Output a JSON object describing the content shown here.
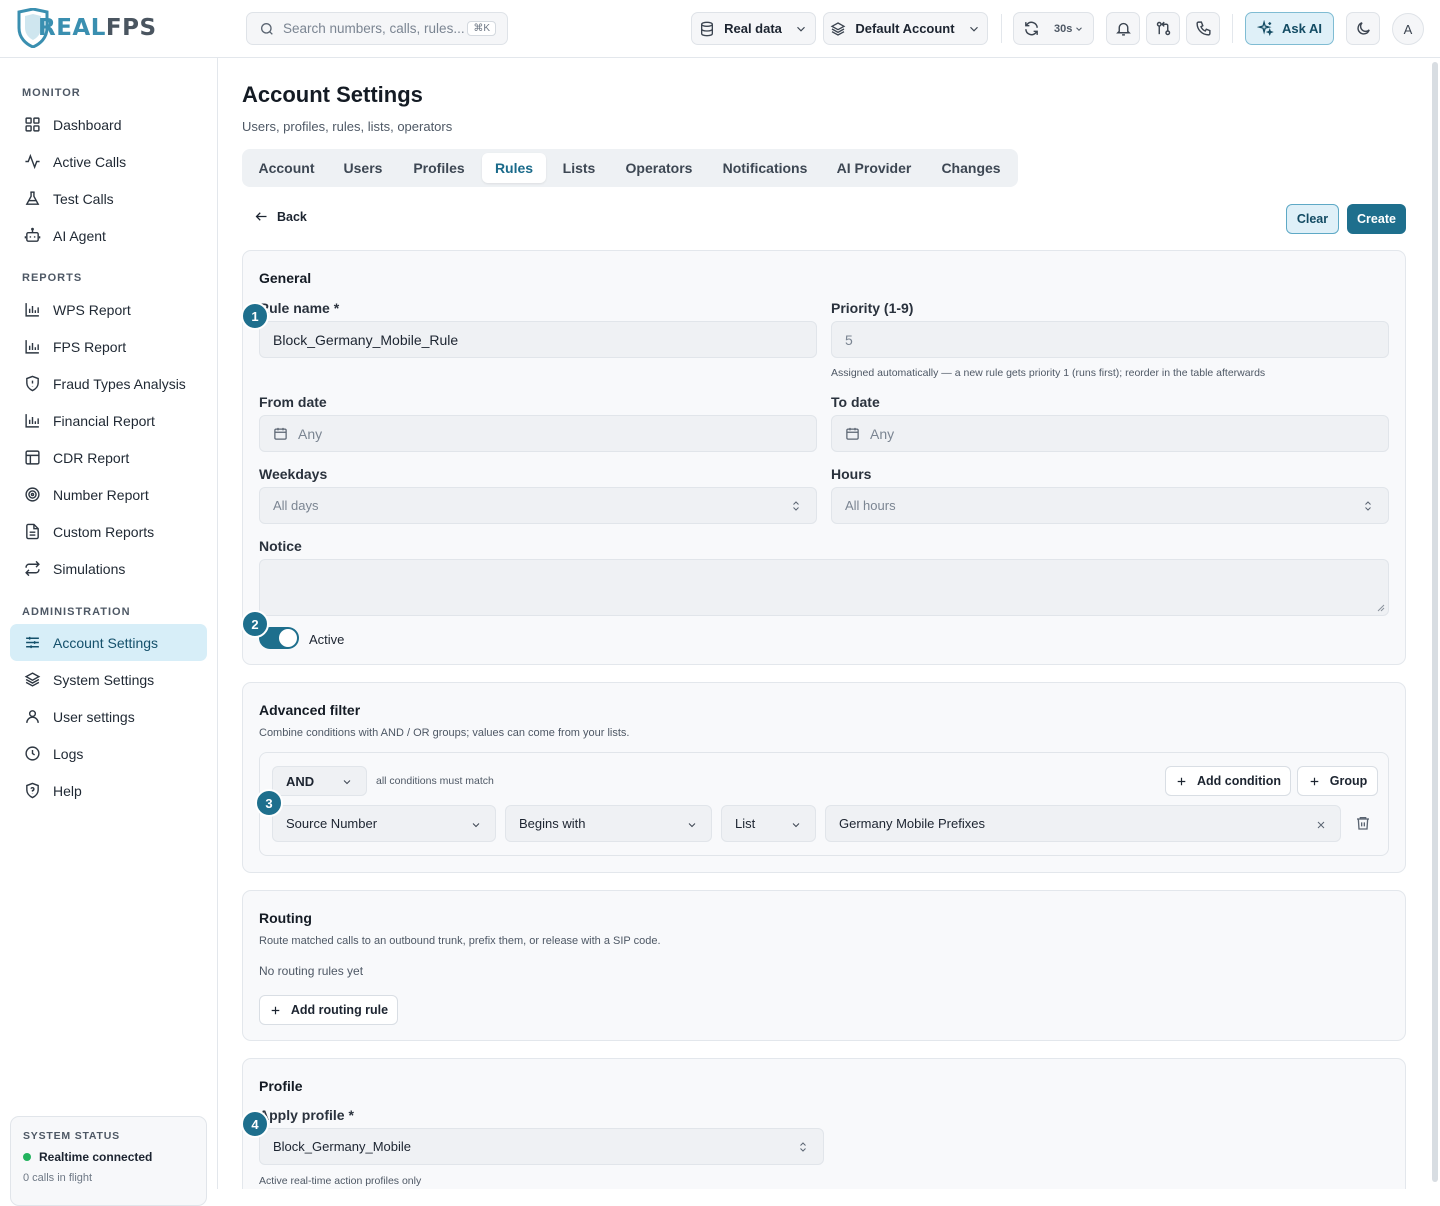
{
  "brand": {
    "logo_prefix": "REAL",
    "logo_suffix": "FPS"
  },
  "header": {
    "search_placeholder": "Search numbers, calls, rules...",
    "search_shortcut": "⌘K",
    "data_source": "Real data",
    "account": "Default Account",
    "refresh_interval": "30s",
    "ask_ai": "Ask AI",
    "avatar_initial": "A"
  },
  "sidebar": {
    "groups": [
      {
        "label": "MONITOR",
        "items": [
          {
            "label": "Dashboard",
            "icon": "dashboard-icon"
          },
          {
            "label": "Active Calls",
            "icon": "activity-icon"
          },
          {
            "label": "Test Calls",
            "icon": "flask-icon"
          },
          {
            "label": "AI Agent",
            "icon": "bot-icon"
          }
        ]
      },
      {
        "label": "REPORTS",
        "items": [
          {
            "label": "WPS Report",
            "icon": "bar-chart-icon"
          },
          {
            "label": "FPS Report",
            "icon": "bar-chart-icon"
          },
          {
            "label": "Fraud Types Analysis",
            "icon": "shield-alert-icon"
          },
          {
            "label": "Financial Report",
            "icon": "bar-chart-icon"
          },
          {
            "label": "CDR Report",
            "icon": "table-icon"
          },
          {
            "label": "Number Report",
            "icon": "target-icon"
          },
          {
            "label": "Custom Reports",
            "icon": "file-text-icon"
          },
          {
            "label": "Simulations",
            "icon": "repeat-icon"
          }
        ]
      },
      {
        "label": "ADMINISTRATION",
        "items": [
          {
            "label": "Account Settings",
            "icon": "sliders-icon",
            "active": true
          },
          {
            "label": "System Settings",
            "icon": "layers-icon"
          },
          {
            "label": "User settings",
            "icon": "user-icon"
          },
          {
            "label": "Logs",
            "icon": "clock-icon"
          },
          {
            "label": "Help",
            "icon": "help-shield-icon"
          }
        ]
      }
    ],
    "status": {
      "title": "SYSTEM STATUS",
      "connection": "Realtime connected",
      "flight": "0 calls in flight",
      "connection_color": "#22b35e"
    }
  },
  "page": {
    "title": "Account Settings",
    "subtitle": "Users, profiles, rules, lists, operators",
    "tabs": [
      "Account",
      "Users",
      "Profiles",
      "Rules",
      "Lists",
      "Operators",
      "Notifications",
      "AI Provider",
      "Changes"
    ],
    "active_tab": "Rules",
    "back_label": "Back",
    "clear_label": "Clear",
    "create_label": "Create",
    "accent_color": "#1e6f8d"
  },
  "general": {
    "title": "General",
    "rule_name_label": "Rule name *",
    "rule_name_value": "Block_Germany_Mobile_Rule",
    "priority_label": "Priority (1-9)",
    "priority_value": "5",
    "priority_hint": "Assigned automatically — a new rule gets priority 1 (runs first); reorder in the table afterwards",
    "from_date_label": "From date",
    "from_date_value": "Any",
    "to_date_label": "To date",
    "to_date_value": "Any",
    "weekdays_label": "Weekdays",
    "weekdays_value": "All days",
    "hours_label": "Hours",
    "hours_value": "All hours",
    "notice_label": "Notice",
    "notice_value": "",
    "active_label": "Active",
    "active": true
  },
  "advanced_filter": {
    "title": "Advanced filter",
    "description": "Combine conditions with AND / OR groups; values can come from your lists.",
    "operator": "AND",
    "operator_hint": "all conditions must match",
    "add_condition_label": "Add condition",
    "add_group_label": "Group",
    "condition": {
      "field": "Source Number",
      "match": "Begins with",
      "value_type": "List",
      "value": "Germany Mobile Prefixes"
    }
  },
  "routing": {
    "title": "Routing",
    "description": "Route matched calls to an outbound trunk, prefix them, or release with a SIP code.",
    "empty_text": "No routing rules yet",
    "add_label": "Add routing rule"
  },
  "profile": {
    "title": "Profile",
    "apply_label": "Apply profile *",
    "apply_value": "Block_Germany_Mobile",
    "hint": "Active real-time action profiles only"
  },
  "step_badges": [
    "1",
    "2",
    "3",
    "4"
  ]
}
